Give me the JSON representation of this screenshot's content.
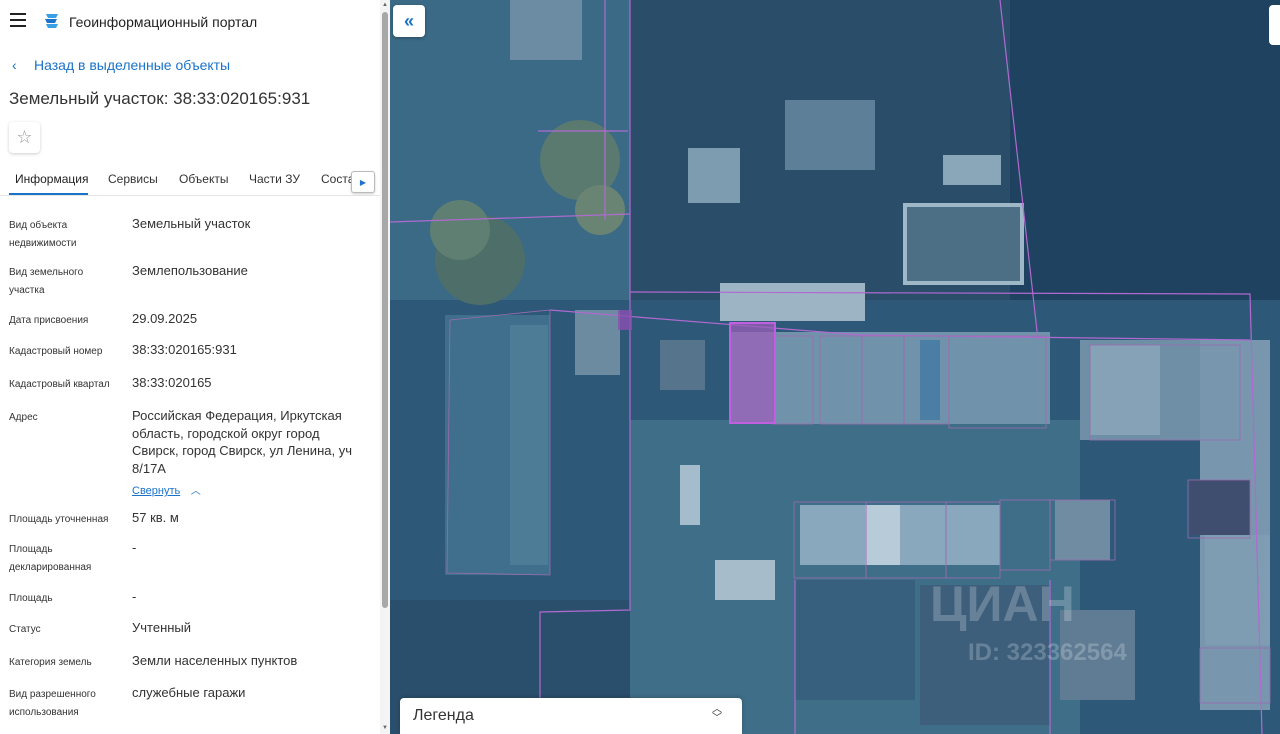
{
  "header": {
    "title": "Геоинформационный портал"
  },
  "nav": {
    "back_label": "Назад в выделенные объекты"
  },
  "object": {
    "title": "Земельный участок: 38:33:020165:931"
  },
  "tabs": [
    {
      "label": "Информация",
      "active": true
    },
    {
      "label": "Сервисы",
      "active": false
    },
    {
      "label": "Объекты",
      "active": false
    },
    {
      "label": "Части ЗУ",
      "active": false
    },
    {
      "label": "Состав",
      "active": false
    }
  ],
  "properties": [
    {
      "label": "Вид объекта недвижимости",
      "value": "Земельный участок"
    },
    {
      "label": "Вид земельного участка",
      "value": "Землепользование"
    },
    {
      "label": "Дата присвоения",
      "value": "29.09.2025"
    },
    {
      "label": "Кадастровый номер",
      "value": "38:33:020165:931"
    },
    {
      "label": "Кадастровый квартал",
      "value": "38:33:020165"
    },
    {
      "label": "Адрес",
      "value": "Российская Федерация, Иркутская область, городской округ город Свирск, город Свирск, ул Ленина, уч 8/17А"
    },
    {
      "label": "Площадь уточненная",
      "value": "57 кв. м"
    },
    {
      "label": "Площадь декларированная",
      "value": "-"
    },
    {
      "label": "Площадь",
      "value": "-"
    },
    {
      "label": "Статус",
      "value": "Учтенный"
    },
    {
      "label": "Категория земель",
      "value": "Земли населенных пунктов"
    },
    {
      "label": "Вид разрешенного использования",
      "value": "служебные гаражи"
    }
  ],
  "address_collapse_label": "Свернуть",
  "map": {
    "legend_label": "Легенда",
    "watermark_brand": "ЦИАН",
    "watermark_id": "ID: 323362564"
  },
  "colors": {
    "accent": "#1a73c9",
    "parcel_outline": "#a040c0",
    "selected_parcel": "#b050c8"
  },
  "icons": {
    "menu": "hamburger-icon",
    "logo": "portal-logo-icon",
    "back": "chevron-left-icon",
    "favorite": "star-icon",
    "tabs_next": "triangle-right-icon",
    "collapse_panel": "double-chevron-left-icon",
    "legend_toggle": "up-down-chevron-icon"
  }
}
